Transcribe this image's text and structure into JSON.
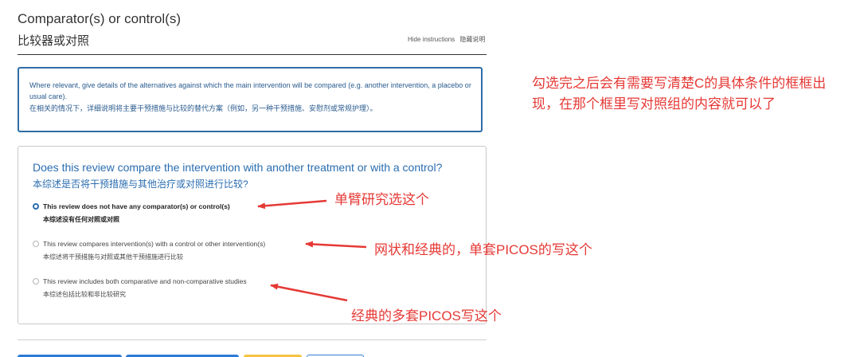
{
  "section": {
    "title": "Comparator(s) or control(s)",
    "subtitle": "比较器或对照",
    "hide_instructions_en": "Hide instructions",
    "hide_instructions_zh": "隐藏说明"
  },
  "instructions": {
    "en": "Where relevant, give details of the alternatives against which the main intervention will be compared (e.g. another intervention, a placebo or usual care).",
    "zh": "在相关的情况下，详细说明将主要干预措施与比较的替代方案（例如，另一种干预措施、安慰剂或常规护理）。"
  },
  "question": {
    "en": "Does this review compare the intervention with another treatment or with a control?",
    "zh": "本综述是否将干预措施与其他治疗或对照进行比较?",
    "selected_index": 0,
    "options": [
      {
        "en": "This review does not have any comparator(s) or control(s)",
        "zh": "本综述没有任何对照或对照"
      },
      {
        "en": "This review compares intervention(s) with a control or other intervention(s)",
        "zh": "本综述将干预措施与对照或其他干预措施进行比较"
      },
      {
        "en": "This review includes both comparative and non-comparative studies",
        "zh": "本综述包括比较和非比较研究"
      }
    ]
  },
  "annotations": {
    "top": "勾选完之后会有需要写清楚C的具体条件的框框出现，在那个框里写对照组的内容就可以了",
    "option1": "单臂研究选这个",
    "option2": "网状和经典的，单套PICOS的写这个",
    "option3": "经典的多套PICOS写这个"
  },
  "colors": {
    "accent_blue": "#2a6db0",
    "annotation_red": "#e53935",
    "button_blue": "#2e7bd6",
    "button_yellow": "#f5c242"
  }
}
